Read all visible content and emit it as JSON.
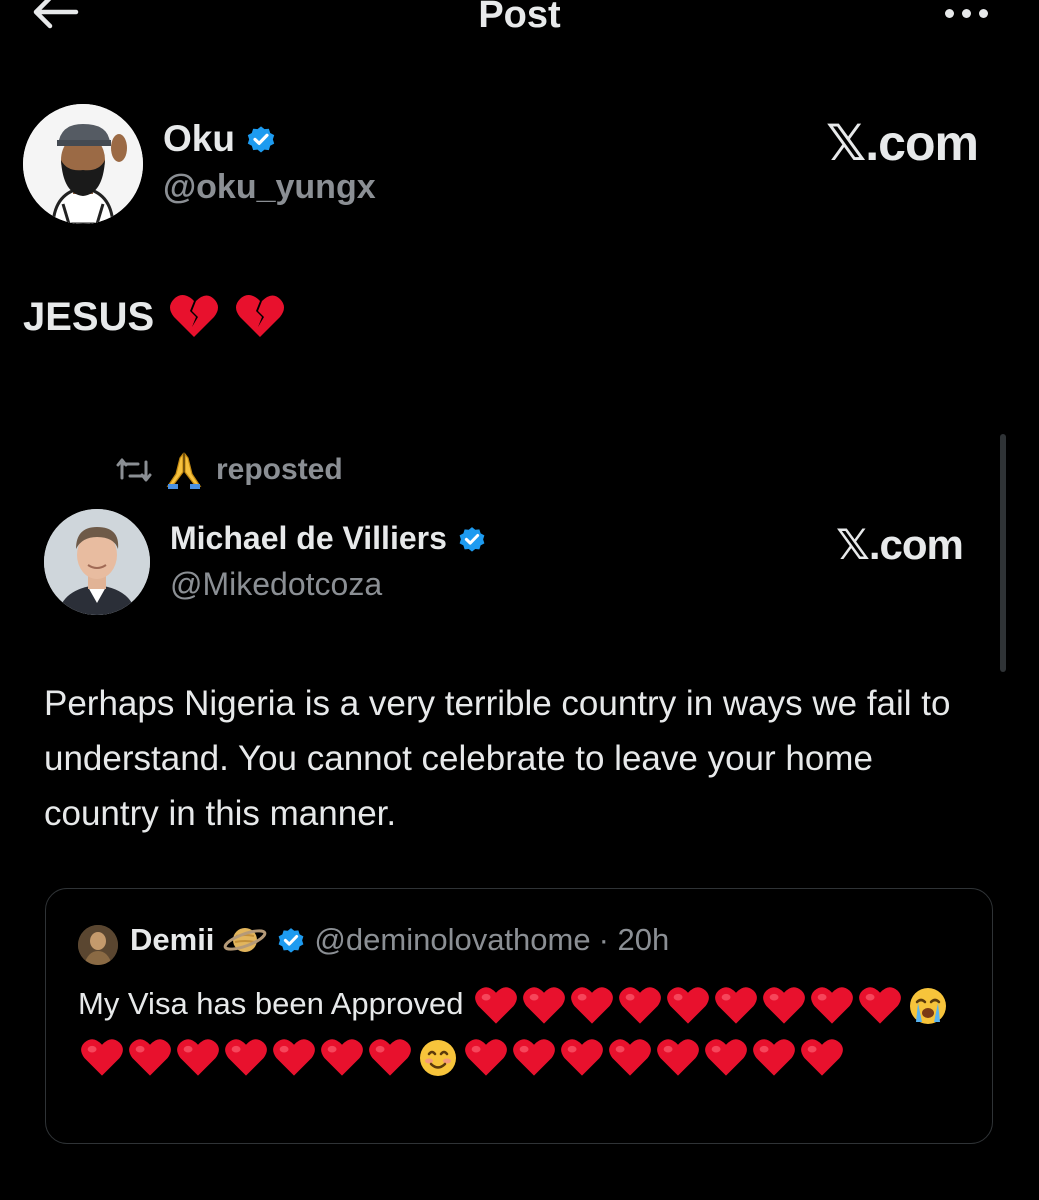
{
  "header": {
    "title": "Post"
  },
  "post": {
    "author": {
      "name": "Oku",
      "handle": "@oku_yungx"
    },
    "source": "𝕏.com",
    "text": "JESUS"
  },
  "repost": {
    "label": "reposted",
    "author": {
      "name": "Michael de Villiers",
      "handle": "@Mikedotcoza"
    },
    "source": "𝕏.com",
    "text": "Perhaps Nigeria is a very terrible country in ways we fail to understand. You cannot celebrate to leave your home country in this manner."
  },
  "quote": {
    "author": {
      "name": "Demii",
      "handle": "@deminolovathome",
      "time": "· 20h"
    },
    "text": "My Visa has been Approved"
  },
  "colors": {
    "background": "#000000",
    "text": "#e7e9ea",
    "secondary": "#8b8f94",
    "verified": "#1d9bf0",
    "heart": "#e8112d"
  },
  "icons": [
    "back-arrow-icon",
    "more-icon",
    "verified-badge-icon",
    "broken-heart-icon",
    "repost-icon",
    "praying-hands-icon",
    "saturn-icon",
    "red-heart-icon",
    "crying-face-icon",
    "smiling-face-icon"
  ]
}
